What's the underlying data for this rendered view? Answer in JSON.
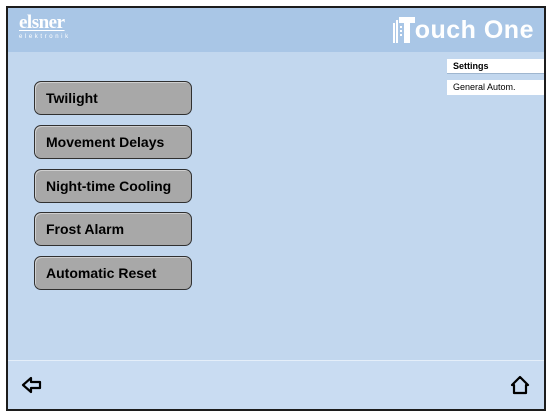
{
  "brand": {
    "logo": "elsner",
    "logo_sub": "elektronik",
    "product": "ouch One"
  },
  "breadcrumb": [
    "Settings",
    "General Autom."
  ],
  "menu": [
    {
      "label": "Twilight"
    },
    {
      "label": "Movement Delays"
    },
    {
      "label": "Night-time Cooling"
    },
    {
      "label": "Frost Alarm"
    },
    {
      "label": "Automatic Reset"
    }
  ],
  "footer": {
    "back_icon": "arrow-left-icon",
    "home_icon": "home-icon"
  },
  "colors": {
    "header_bg": "#a9c6e6",
    "screen_bg": "#c2d7ee",
    "button_bg": "#a8a8a8"
  }
}
